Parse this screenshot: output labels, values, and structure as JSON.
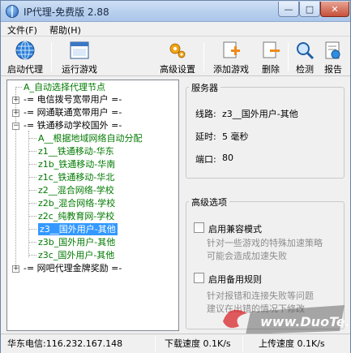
{
  "window": {
    "title": "IP代理-免费版 2.88",
    "min_glyph": "—",
    "max_glyph": "□",
    "close_glyph": "✕"
  },
  "menu": [
    "文件(F)",
    "帮助(H)"
  ],
  "toolbar": {
    "start_proxy": "启动代理",
    "run_game": "运行游戏",
    "advanced": "高级设置",
    "add_game": "添加游戏",
    "delete": "删除",
    "check": "检测",
    "report": "报告"
  },
  "tree": {
    "items": [
      {
        "text": "A_自动选择代理节点",
        "color": "green"
      },
      {
        "text": "-= 电信拨号宽带用户 =-",
        "color": "black",
        "toggle": "+"
      },
      {
        "text": "-= 网通联通宽带用户 =-",
        "color": "black",
        "toggle": "+"
      },
      {
        "text": "-= 铁通移动学校国外 =-",
        "color": "black",
        "toggle": "−"
      },
      {
        "text": "A__根据地域网络自动分配",
        "color": "green"
      },
      {
        "text": "z1__铁通移动-华东",
        "color": "green"
      },
      {
        "text": "z1b_铁通移动-华南",
        "color": "green"
      },
      {
        "text": "z1c_铁通移动-华北",
        "color": "green"
      },
      {
        "text": "z2__混合网络-学校",
        "color": "green"
      },
      {
        "text": "z2b_混合网络-学校",
        "color": "green"
      },
      {
        "text": "z2c_纯教育网-学校",
        "color": "green"
      },
      {
        "text": "z3__国外用户-其他",
        "color": "selected"
      },
      {
        "text": "z3b_国外用户-其他",
        "color": "green"
      },
      {
        "text": "z3c_国外用户-其他",
        "color": "green"
      },
      {
        "text": "-= 网吧代理金牌奖励 =-",
        "color": "black",
        "toggle": "+"
      }
    ]
  },
  "server": {
    "title": "服务器",
    "route_label": "线路:",
    "route_value": "z3__国外用户-其他",
    "latency_label": "延时:",
    "latency_value": "5 毫秒",
    "port_label": "端口:",
    "port_value": "80"
  },
  "advanced_options": {
    "title": "高级选项",
    "compat_label": "启用兼容模式",
    "compat_desc_1": "针对一些游戏的特殊加速策略",
    "compat_desc_2": "可能会造成加速失败",
    "backup_label": "启用备用规则",
    "backup_desc_1": "针对报错和连接失败等问题",
    "backup_desc_2": "建议在出错的情况下修改"
  },
  "status": {
    "isp": "华东电信:116.232.167.148",
    "down": "下载速度 0.1K/s",
    "up": "上传速度 0.1K/s"
  },
  "watermark_text": "www.DuoTe.com",
  "colors": {
    "tree_green": "#007a00",
    "selection": "#3399ff"
  }
}
